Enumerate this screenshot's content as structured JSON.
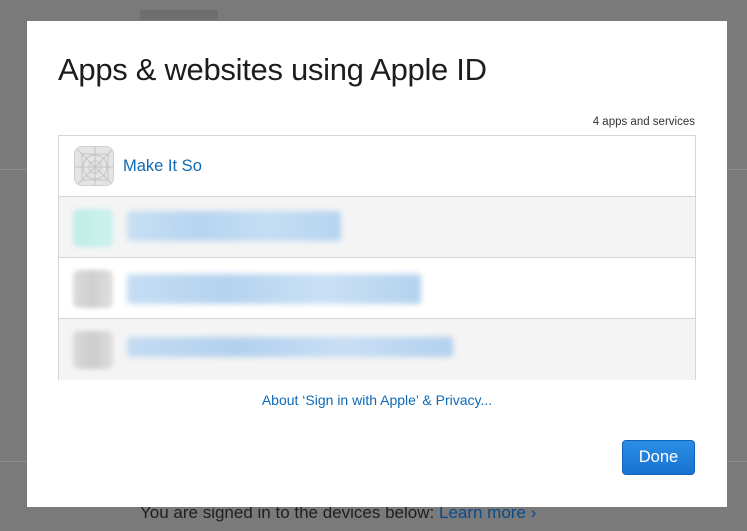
{
  "background": {
    "footer_text": "You are signed in to the devices below:",
    "footer_link": "Learn more",
    "footer_chevron": "›"
  },
  "dialog": {
    "title": "Apps & websites using Apple ID",
    "count_text": "4 apps and services",
    "apps": [
      {
        "name": "Make It So",
        "icon": "app-placeholder-icon",
        "obscured": false
      },
      {
        "name": "",
        "icon": "blurred-app-icon",
        "obscured": true
      },
      {
        "name": "",
        "icon": "blurred-app-icon",
        "obscured": true
      },
      {
        "name": "",
        "icon": "blurred-app-icon",
        "obscured": true
      }
    ],
    "privacy_link": "About ‘Sign in with Apple’ & Privacy...",
    "done_label": "Done"
  },
  "colors": {
    "overlay": "#7a7a7a",
    "link": "#0e6ab8",
    "button": "#1a7ad8",
    "row_alt": "#f4f4f4",
    "border": "#d6d6d6"
  }
}
